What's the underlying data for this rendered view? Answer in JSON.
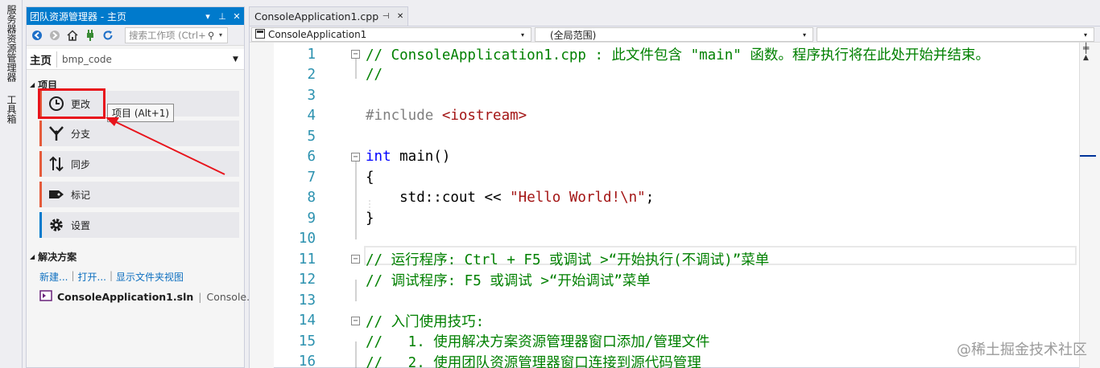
{
  "left_strip": {
    "tab1": "服务器资源管理器",
    "tab2": "工具箱"
  },
  "team_explorer": {
    "title": "团队资源管理器 - 主页",
    "search_placeholder": "搜索工作项 (Ctrl+",
    "home_label": "主页",
    "repo_name": "bmp_code",
    "project_section": "项目",
    "items": [
      {
        "label": "更改",
        "icon": "clock-icon",
        "accent": "#e55b3b"
      },
      {
        "label": "分支",
        "icon": "branch-icon",
        "accent": "#e55b3b"
      },
      {
        "label": "同步",
        "icon": "sync-icon",
        "accent": "#e55b3b"
      },
      {
        "label": "标记",
        "icon": "tag-icon",
        "accent": "#e55b3b"
      },
      {
        "label": "设置",
        "icon": "gear-icon",
        "accent": "#007acc"
      }
    ],
    "tooltip": "项目 (Alt+1)",
    "solution_section": "解决方案",
    "links": [
      "新建...",
      "打开...",
      "显示文件夹视图"
    ],
    "solution_file": "ConsoleApplication1.sln",
    "solution_project": "Console..."
  },
  "editor": {
    "tab_title": "ConsoleApplication1.cpp",
    "project_combo": "ConsoleApplication1",
    "scope_combo": "(全局范围)",
    "member_combo": "",
    "lines": [
      {
        "n": "1",
        "fold": "−",
        "parts": [
          {
            "c": "cm",
            "t": "// ConsoleApplication1.cpp : 此文件包含 \"main\" 函数。程序执行将在此处开始并结束。"
          }
        ]
      },
      {
        "n": "2",
        "fold": "",
        "parts": [
          {
            "c": "cm",
            "t": "//"
          }
        ]
      },
      {
        "n": "3",
        "fold": "",
        "parts": []
      },
      {
        "n": "4",
        "fold": "",
        "parts": [
          {
            "c": "pp",
            "t": "#include "
          },
          {
            "c": "st",
            "t": "<iostream>"
          }
        ]
      },
      {
        "n": "5",
        "fold": "",
        "parts": []
      },
      {
        "n": "6",
        "fold": "−",
        "parts": [
          {
            "c": "kw",
            "t": "int"
          },
          {
            "c": "tx",
            "t": " main()"
          }
        ]
      },
      {
        "n": "7",
        "fold": "",
        "parts": [
          {
            "c": "tx",
            "t": "{"
          }
        ]
      },
      {
        "n": "8",
        "fold": "",
        "parts": [
          {
            "c": "tx",
            "t": "    std::cout << "
          },
          {
            "c": "st",
            "t": "\"Hello World!\\n\""
          },
          {
            "c": "tx",
            "t": ";"
          }
        ]
      },
      {
        "n": "9",
        "fold": "",
        "parts": [
          {
            "c": "tx",
            "t": "}"
          }
        ]
      },
      {
        "n": "10",
        "fold": "",
        "parts": []
      },
      {
        "n": "11",
        "fold": "−",
        "parts": [
          {
            "c": "cm",
            "t": "// 运行程序: Ctrl + F5 或调试 >“开始执行(不调试)”菜单"
          }
        ]
      },
      {
        "n": "12",
        "fold": "",
        "parts": [
          {
            "c": "cm",
            "t": "// 调试程序: F5 或调试 >“开始调试”菜单"
          }
        ]
      },
      {
        "n": "13",
        "fold": "",
        "parts": []
      },
      {
        "n": "14",
        "fold": "−",
        "parts": [
          {
            "c": "cm",
            "t": "// 入门使用技巧:"
          }
        ]
      },
      {
        "n": "15",
        "fold": "",
        "parts": [
          {
            "c": "cm",
            "t": "//   1. 使用解决方案资源管理器窗口添加/管理文件"
          }
        ]
      },
      {
        "n": "16",
        "fold": "",
        "parts": [
          {
            "c": "cm",
            "t": "//   2. 使用团队资源管理器窗口连接到源代码管理"
          }
        ]
      }
    ]
  },
  "watermark": "@稀土掘金技术社区",
  "colors": {
    "accent": "#007acc",
    "highlight": "#e8141c",
    "arrow": "#e8141c"
  }
}
